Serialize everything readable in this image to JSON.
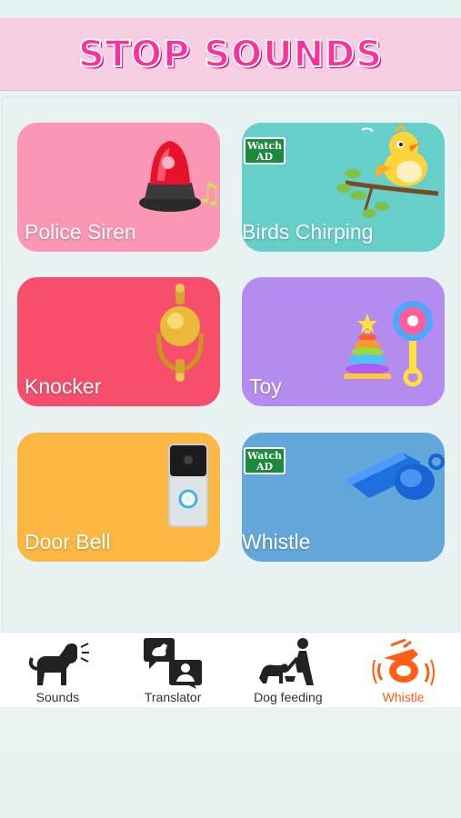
{
  "header": {
    "title": "STOP SOUNDS"
  },
  "colors": {
    "title_pink": "#ff2f9e",
    "police": "#fb96b5",
    "birds": "#66cfca",
    "knocker": "#f74e6c",
    "toy": "#b48cef",
    "doorbell": "#fbb742",
    "whistle": "#63a7da",
    "nav_active": "#ff5e13"
  },
  "cards": [
    {
      "label": "Police Siren",
      "icon": "police-siren-icon",
      "ad": false
    },
    {
      "label": "Birds Chirping",
      "icon": "bird-icon",
      "ad": true
    },
    {
      "label": "Knocker",
      "icon": "door-knocker-icon",
      "ad": false
    },
    {
      "label": "Toy",
      "icon": "toy-icon",
      "ad": false
    },
    {
      "label": "Door Bell",
      "icon": "doorbell-icon",
      "ad": false
    },
    {
      "label": "Whistle",
      "icon": "whistle-icon",
      "ad": true
    }
  ],
  "ad_badge": {
    "line1": "Watch",
    "line2": "AD"
  },
  "nav": {
    "items": [
      {
        "label": "Sounds",
        "icon": "barking-dog-icon",
        "active": false
      },
      {
        "label": "Translator",
        "icon": "translator-icon",
        "active": false
      },
      {
        "label": "Dog feeding",
        "icon": "dog-feeding-icon",
        "active": false
      },
      {
        "label": "Whistle",
        "icon": "whistle-icon",
        "active": true
      }
    ]
  }
}
